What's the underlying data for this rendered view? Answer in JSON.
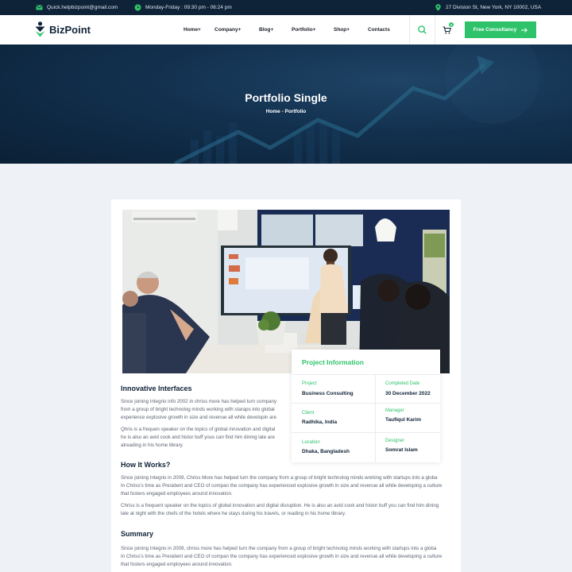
{
  "topbar": {
    "email": "Quick.helpbizpoint@gmail.com",
    "hours": "Monday-Friday : 09:30 pm - 06:24 pm",
    "address": "27 Division St, New York, NY 10002, USA"
  },
  "nav": {
    "logo": "BizPoint",
    "items": [
      "Home+",
      "Company+",
      "Blog+",
      "Portfolio+",
      "Shop+",
      "Contacts"
    ],
    "cart_count": "0",
    "cta": "Free Consultancy"
  },
  "hero": {
    "title": "Portfolio Single",
    "breadcrumb": "Home - Portfolio"
  },
  "project_info": {
    "title": "Project Information",
    "fields": [
      {
        "label": "Project",
        "value": "Business Consulting"
      },
      {
        "label": "Completed Date",
        "value": "30 December 2022"
      },
      {
        "label": "Client",
        "value": "Radhika, India"
      },
      {
        "label": "Manager",
        "value": "Taufiqul Karim"
      },
      {
        "label": "Location",
        "value": "Dhaka, Bangladesh"
      },
      {
        "label": "Designer",
        "value": "Somrat Islam"
      }
    ]
  },
  "content": {
    "s1_title": "Innovative Interfaces",
    "s1_p1": [
      "Since joining Integrio info 2002 in chriss more has helped turn company",
      "from a group of bright technolog minds working with staraps into global",
      "experience explosive growth in size and revenue all while developin are"
    ],
    "s1_p2": [
      "Qhris is a frequen speaker on the topics of global innovation and digital",
      "he is also an avid cook and histor buff yous can find him dining late are",
      "atreading in his home library."
    ],
    "s2_title": "How It Works?",
    "s2_p1": [
      "Since joining Integrio in 2009, Chriss More has helped turn the company from a group of bright technolog minds working with startups into a globa",
      "In Chriss's time as President and CEO of compan the company has experienced explosive growth in size and revenue all while developing a culture",
      "that fosters engaged employees around innovation."
    ],
    "s2_p2": [
      "Chriss is a frequent speaker on the topics of global innovation and digital disruption. He is also an avid cook and histor buff you can find him dining",
      "late at night with the chefs of the hotels where he stays during his travels, or reading in his home library."
    ],
    "s3_title": "Summary",
    "s3_p1": [
      "Since joining Integrio in 2009, chriss more has helped turn the company from a group of bright technolog minds working with startups into a globa",
      "In Chriss's time as President and CEO of compan the company has experienced explosive growth in size and revenue all while developing a culture",
      "that fosters engaged employees around innovation."
    ]
  },
  "colors": {
    "accent": "#2ec36a",
    "dark": "#0f2338"
  },
  "icons": [
    "mail-icon",
    "clock-icon",
    "location-pin-icon",
    "search-icon",
    "cart-icon",
    "arrow-right-icon"
  ]
}
